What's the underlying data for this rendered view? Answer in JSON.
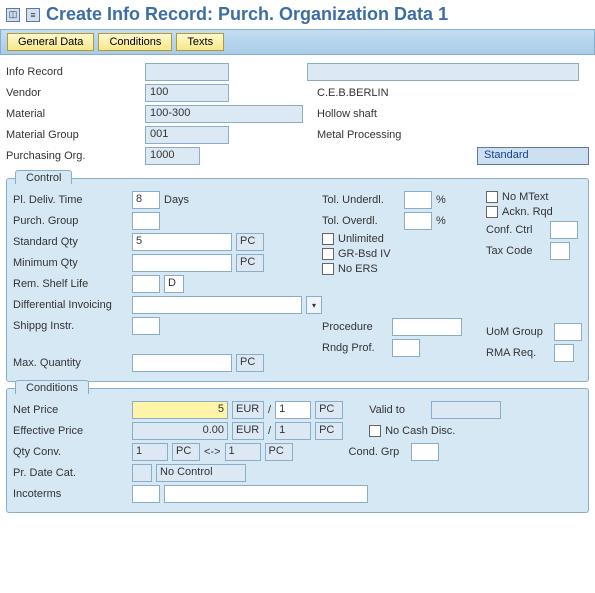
{
  "title": "Create Info Record: Purch. Organization Data 1",
  "tabs": {
    "general": "General Data",
    "conditions": "Conditions",
    "texts": "Texts"
  },
  "header": {
    "info_record_label": "Info Record",
    "info_record": "",
    "info_record_desc": "",
    "vendor_label": "Vendor",
    "vendor": "100",
    "vendor_desc": "C.E.B.BERLIN",
    "material_label": "Material",
    "material": "100-300",
    "material_desc": "Hollow shaft",
    "matgroup_label": "Material Group",
    "matgroup": "001",
    "matgroup_desc": "Metal Processing",
    "purchorg_label": "Purchasing Org.",
    "purchorg": "1000",
    "category_link": "Standard"
  },
  "control": {
    "title": "Control",
    "pldeliv_label": "Pl. Deliv. Time",
    "pldeliv": "8",
    "pldeliv_unit": "Days",
    "purchgroup_label": "Purch. Group",
    "purchgroup": "",
    "stdqty_label": "Standard Qty",
    "stdqty": "5",
    "stdqty_uom": "PC",
    "minqty_label": "Minimum Qty",
    "minqty": "",
    "minqty_uom": "PC",
    "shelf_label": "Rem. Shelf Life",
    "shelf": "",
    "shelf_unit": "D",
    "diffinv_label": "Differential Invoicing",
    "diffinv": "",
    "shipinstr_label": "Shippg Instr.",
    "shipinstr": "",
    "maxqty_label": "Max. Quantity",
    "maxqty": "",
    "maxqty_uom": "PC",
    "tolunder_label": "Tol. Underdl.",
    "tolunder": "",
    "pct": "%",
    "tolover_label": "Tol. Overdl.",
    "tolover": "",
    "unlimited_label": "Unlimited",
    "grbsd_label": "GR-Bsd IV",
    "noers_label": "No ERS",
    "procedure_label": "Procedure",
    "procedure": "",
    "rndgprof_label": "Rndg Prof.",
    "rndgprof": "",
    "nomtext_label": "No MText",
    "acknrqd_label": "Ackn. Rqd",
    "confctrl_label": "Conf. Ctrl",
    "confctrl": "",
    "taxcode_label": "Tax Code",
    "taxcode": "",
    "uomgroup_label": "UoM Group",
    "uomgroup": "",
    "rmareq_label": "RMA Req.",
    "rmareq": ""
  },
  "conditions": {
    "title": "Conditions",
    "netprice_label": "Net Price",
    "netprice": "5",
    "currency": "EUR",
    "slash": "/",
    "per": "1",
    "uom": "PC",
    "effprice_label": "Effective Price",
    "effprice": "0.00",
    "qtyconv_label": "Qty Conv.",
    "qtyconv_from": "1",
    "qtyconv_from_uom": "PC",
    "arrow": "<->",
    "qtyconv_to": "1",
    "qtyconv_to_uom": "PC",
    "prdatecat_label": "Pr. Date Cat.",
    "prdatecat": "",
    "prdatecat_txt": "No Control",
    "incoterms_label": "Incoterms",
    "incoterms1": "",
    "incoterms2": "",
    "validto_label": "Valid to",
    "validto": "",
    "nocash_label": "No Cash Disc.",
    "condgrp_label": "Cond. Grp",
    "condgrp": ""
  }
}
